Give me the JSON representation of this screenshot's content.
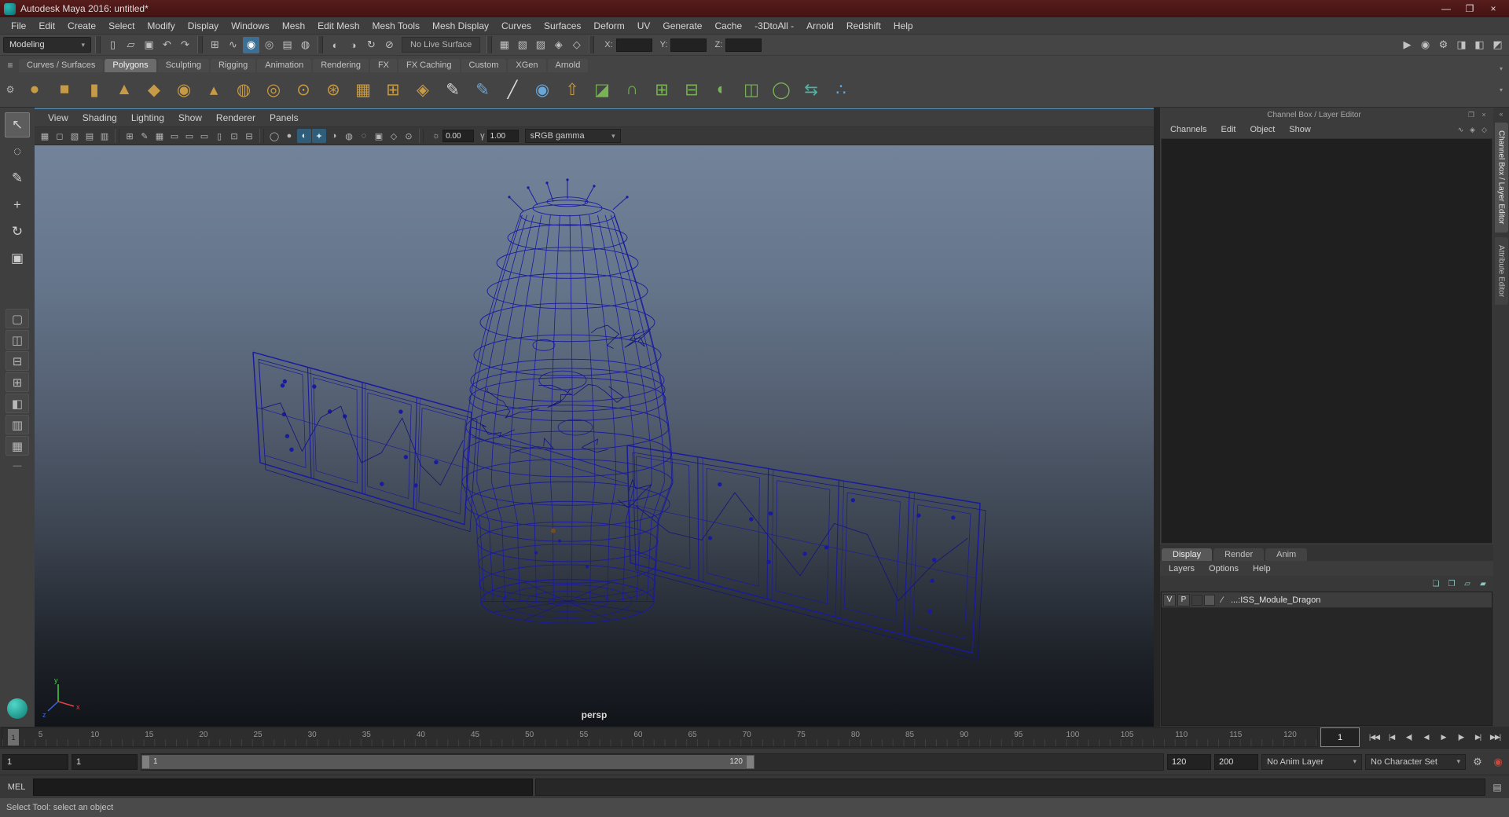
{
  "window": {
    "title": "Autodesk Maya 2016: untitled*",
    "controls": [
      {
        "name": "minimize-button",
        "g": "—"
      },
      {
        "name": "maximize-button",
        "g": "❐"
      },
      {
        "name": "close-button",
        "g": "×"
      }
    ]
  },
  "menubar": {
    "items": [
      "File",
      "Edit",
      "Create",
      "Select",
      "Modify",
      "Display",
      "Windows",
      "Mesh",
      "Edit Mesh",
      "Mesh Tools",
      "Mesh Display",
      "Curves",
      "Surfaces",
      "Deform",
      "UV",
      "Generate",
      "Cache",
      "-3DtoAll -",
      "Arnold",
      "Redshift",
      "Help"
    ]
  },
  "statusline": {
    "mode": "Modeling",
    "file_icons": [
      {
        "name": "new-scene-icon",
        "g": "▯"
      },
      {
        "name": "open-scene-icon",
        "g": "▱"
      },
      {
        "name": "save-scene-icon",
        "g": "▣"
      },
      {
        "name": "undo-icon",
        "g": "↶"
      },
      {
        "name": "redo-icon",
        "g": "↷"
      }
    ],
    "snap_icons": [
      {
        "name": "snap-to-grids-icon",
        "g": "⊞"
      },
      {
        "name": "snap-to-curves-icon",
        "g": "∿"
      },
      {
        "name": "snap-to-points-icon",
        "g": "◉",
        "active": true
      },
      {
        "name": "snap-to-projected-center-icon",
        "g": "◎"
      },
      {
        "name": "snap-to-view-planes-icon",
        "g": "▤"
      },
      {
        "name": "make-object-live-icon",
        "g": "◍"
      }
    ],
    "history_icons": [
      {
        "name": "input-connections-icon",
        "g": "◐"
      },
      {
        "name": "output-connections-icon",
        "g": "◑"
      },
      {
        "name": "construction-history-icon",
        "g": "↻"
      },
      {
        "name": "no-construction-history-icon",
        "g": "⊘"
      }
    ],
    "no_live_surface": "No Live Surface",
    "mask_icons": [
      {
        "name": "select-hierarchy-mask-icon",
        "g": "▦"
      },
      {
        "name": "select-object-mask-icon",
        "g": "▧"
      },
      {
        "name": "select-component-mask-icon",
        "g": "▨"
      },
      {
        "name": "lock-selection-icon",
        "g": "◈"
      },
      {
        "name": "highlight-selection-icon",
        "g": "◇"
      }
    ],
    "x_label": "X:",
    "y_label": "Y:",
    "z_label": "Z:",
    "right_icons": [
      {
        "name": "render-view-icon",
        "g": "▶"
      },
      {
        "name": "ipr-render-icon",
        "g": "◉"
      },
      {
        "name": "render-settings-icon",
        "g": "⚙"
      },
      {
        "name": "show-attribute-editor-icon",
        "g": "◨"
      },
      {
        "name": "show-tool-settings-icon",
        "g": "◧"
      },
      {
        "name": "show-channel-box-icon",
        "g": "◩"
      }
    ]
  },
  "shelf": {
    "tabs_menu_glyph": "≡",
    "gear_glyph": "⚙",
    "overflow_glyph": "▾",
    "tabs": [
      {
        "label": "Curves / Surfaces"
      },
      {
        "label": "Polygons",
        "active": true
      },
      {
        "label": "Sculpting"
      },
      {
        "label": "Rigging"
      },
      {
        "label": "Animation"
      },
      {
        "label": "Rendering"
      },
      {
        "label": "FX"
      },
      {
        "label": "FX Caching"
      },
      {
        "label": "Custom"
      },
      {
        "label": "XGen"
      },
      {
        "label": "Arnold"
      }
    ],
    "icons": [
      {
        "name": "poly-sphere-icon",
        "g": "●",
        "cls": "gold"
      },
      {
        "name": "poly-cube-icon",
        "g": "■",
        "cls": "gold"
      },
      {
        "name": "poly-cylinder-icon",
        "g": "▮",
        "cls": "gold"
      },
      {
        "name": "poly-cone-icon",
        "g": "▲",
        "cls": "gold"
      },
      {
        "name": "poly-platonic-icon",
        "g": "◆",
        "cls": "gold"
      },
      {
        "name": "poly-sphere-smooth-icon",
        "g": "◉",
        "cls": "gold"
      },
      {
        "name": "poly-pyramid-icon",
        "g": "▴",
        "cls": "gold"
      },
      {
        "name": "poly-pipe-icon",
        "g": "◍",
        "cls": "gold"
      },
      {
        "name": "poly-torus-icon",
        "g": "◎",
        "cls": "gold"
      },
      {
        "name": "poly-disc-icon",
        "g": "⊙",
        "cls": "gold"
      },
      {
        "name": "poly-gear-icon",
        "g": "⊛",
        "cls": "gold"
      },
      {
        "name": "poly-plane-icon",
        "g": "▦",
        "cls": "gold"
      },
      {
        "name": "poly-grid-icon",
        "g": "⊞",
        "cls": "gold"
      },
      {
        "name": "poly-superellipse-icon",
        "g": "◈",
        "cls": "gold"
      },
      {
        "name": "curve-pencil-icon",
        "g": "✎",
        "cls": "white"
      },
      {
        "name": "quad-draw-icon",
        "g": "✎",
        "cls": "blue"
      },
      {
        "name": "multi-cut-icon",
        "g": "╱",
        "cls": "white"
      },
      {
        "name": "sculpt-brush-icon",
        "g": "◉",
        "cls": "blue"
      },
      {
        "name": "extrude-icon",
        "g": "⇧",
        "cls": "gold"
      },
      {
        "name": "bevel-icon",
        "g": "◪",
        "cls": "green"
      },
      {
        "name": "bridge-icon",
        "g": "∩",
        "cls": "green"
      },
      {
        "name": "combine-icon",
        "g": "⊞",
        "cls": "green"
      },
      {
        "name": "separate-icon",
        "g": "⊟",
        "cls": "green"
      },
      {
        "name": "boolean-icon",
        "g": "◐",
        "cls": "green"
      },
      {
        "name": "mirror-icon",
        "g": "◫",
        "cls": "green"
      },
      {
        "name": "smooth-icon",
        "g": "◯",
        "cls": "green"
      },
      {
        "name": "symmetrize-icon",
        "g": "⇆",
        "cls": "teal"
      },
      {
        "name": "node-editor-icon",
        "g": "∴",
        "cls": "blue"
      }
    ]
  },
  "toolbox": {
    "tools": [
      {
        "name": "select-tool",
        "g": "↖",
        "active": true
      },
      {
        "name": "lasso-select-tool",
        "g": "◌"
      },
      {
        "name": "paint-select-tool",
        "g": "✎"
      },
      {
        "name": "move-tool",
        "g": "+"
      },
      {
        "name": "rotate-tool",
        "g": "↻"
      },
      {
        "name": "scale-tool",
        "g": "▣"
      }
    ],
    "layouts": [
      {
        "name": "single-pane-layout-button",
        "g": "▢"
      },
      {
        "name": "two-pane-side-layout-button",
        "g": "◫"
      },
      {
        "name": "two-pane-stacked-layout-button",
        "g": "⊟"
      },
      {
        "name": "four-pane-layout-button",
        "g": "⊞"
      },
      {
        "name": "persp-outliner-layout-button",
        "g": "◧"
      },
      {
        "name": "persp-graph-layout-button",
        "g": "▥"
      },
      {
        "name": "hypershade-persp-layout-button",
        "g": "▦"
      }
    ],
    "dash": "—"
  },
  "viewport": {
    "menus": [
      "View",
      "Shading",
      "Lighting",
      "Show",
      "Renderer",
      "Panels"
    ],
    "toolbar_icons_a": [
      {
        "name": "select-camera-icon",
        "g": "▦"
      },
      {
        "name": "lock-camera-icon",
        "g": "◻"
      },
      {
        "name": "camera-attributes-icon",
        "g": "▧"
      },
      {
        "name": "bookmarks-icon",
        "g": "▤"
      },
      {
        "name": "image-plane-icon",
        "g": "▥"
      }
    ],
    "toolbar_icons_b": [
      {
        "name": "2d-pan-zoom-icon",
        "g": "⊞"
      },
      {
        "name": "grease-pencil-icon",
        "g": "✎"
      },
      {
        "name": "grid-icon",
        "g": "▦"
      },
      {
        "name": "film-gate-icon",
        "g": "▭"
      },
      {
        "name": "resolution-gate-icon",
        "g": "▭"
      },
      {
        "name": "gate-mask-icon",
        "g": "▭"
      },
      {
        "name": "field-chart-icon",
        "g": "▯"
      },
      {
        "name": "safe-action-icon",
        "g": "⊡"
      },
      {
        "name": "safe-title-icon",
        "g": "⊟"
      }
    ],
    "toolbar_icons_c": [
      {
        "name": "wireframe-mode-icon",
        "g": "◯"
      },
      {
        "name": "smooth-shade-mode-icon",
        "g": "●"
      },
      {
        "name": "textured-mode-icon",
        "g": "◐",
        "cls": "on"
      },
      {
        "name": "use-all-lights-icon",
        "g": "✦",
        "cls": "on"
      },
      {
        "name": "shadows-icon",
        "g": "◑"
      },
      {
        "name": "screen-space-ao-icon",
        "g": "◍"
      },
      {
        "name": "motion-blur-icon",
        "g": "◌"
      },
      {
        "name": "multisample-aa-icon",
        "g": "▣"
      },
      {
        "name": "xray-mode-icon",
        "g": "◇"
      },
      {
        "name": "isolate-select-icon",
        "g": "⊙"
      }
    ],
    "exposure_icon": "☼",
    "exposure": "0.00",
    "gamma_icon": "γ",
    "gamma": "1.00",
    "color_space": "sRGB gamma",
    "camera_label": "persp",
    "axis": {
      "x": "x",
      "y": "y",
      "z": "z"
    }
  },
  "channel_box": {
    "header": "Channel Box / Layer Editor",
    "header_icons": [
      {
        "name": "dock-panel-icon",
        "g": "❐"
      },
      {
        "name": "close-panel-icon",
        "g": "×"
      }
    ],
    "menus": [
      "Channels",
      "Edit",
      "Object",
      "Show"
    ],
    "tool_icons": [
      {
        "name": "channel-slider-speed-icon",
        "g": "∿"
      },
      {
        "name": "channel-stat-icon",
        "g": "◈"
      },
      {
        "name": "channel-manip-icon",
        "g": "◇"
      }
    ],
    "layer_tabs": [
      {
        "label": "Display",
        "active": true
      },
      {
        "label": "Render"
      },
      {
        "label": "Anim"
      }
    ],
    "layer_menus": [
      "Layers",
      "Options",
      "Help"
    ],
    "layer_icons": [
      {
        "name": "layer-move-up-icon",
        "g": "❏"
      },
      {
        "name": "layer-move-down-icon",
        "g": "❐"
      },
      {
        "name": "new-empty-layer-icon",
        "g": "▱"
      },
      {
        "name": "new-layer-from-selected-icon",
        "g": "▰"
      }
    ],
    "layer_row": {
      "v": "V",
      "p": "P",
      "icon_glyph": "∕",
      "name": "...:ISS_Module_Dragon"
    }
  },
  "right_strip": {
    "collapse_glyph": "«",
    "tabs": [
      {
        "label": "Channel Box / Layer Editor",
        "active": true
      },
      {
        "label": "Attribute Editor"
      }
    ]
  },
  "timeline": {
    "labels": [
      "5",
      "10",
      "15",
      "20",
      "25",
      "30",
      "35",
      "40",
      "45",
      "50",
      "55",
      "60",
      "65",
      "70",
      "75",
      "80",
      "85",
      "90",
      "95",
      "100",
      "105",
      "110",
      "115",
      "120"
    ],
    "marker": "1",
    "current_frame": "1",
    "playback": [
      {
        "name": "go-to-start-button",
        "g": "|◀◀"
      },
      {
        "name": "step-back-key-button",
        "g": "|◀"
      },
      {
        "name": "step-back-frame-button",
        "g": "◀|"
      },
      {
        "name": "play-backwards-button",
        "g": "◀"
      },
      {
        "name": "play-forwards-button",
        "g": "▶"
      },
      {
        "name": "step-forward-frame-button",
        "g": "|▶"
      },
      {
        "name": "step-forward-key-button",
        "g": "▶|"
      },
      {
        "name": "go-to-end-button",
        "g": "▶▶|"
      }
    ]
  },
  "range": {
    "anim_start": "1",
    "play_start": "1",
    "play_end": "120",
    "anim_end": "200",
    "anim_layer": "No Anim Layer",
    "character_set": "No Character Set",
    "prefs_glyph": "⚙",
    "autokey_glyph": "◉"
  },
  "command_line": {
    "label": "MEL",
    "icon_glyph": "▤"
  },
  "help_line": {
    "text": "Select Tool: select an object"
  },
  "colors": {
    "titlebar": "#4b1717",
    "accent_highlight": "#3d6f94",
    "active_panel_border": "#3f7ca6",
    "wireframe": "#1a1a9e",
    "viewport_gradient_top": "#72839a",
    "viewport_gradient_bottom": "#111419",
    "shelf_gold": "#c79a45",
    "shelf_green": "#79b356",
    "shelf_teal": "#4fb3a4",
    "autokey_red": "#c8493b"
  }
}
